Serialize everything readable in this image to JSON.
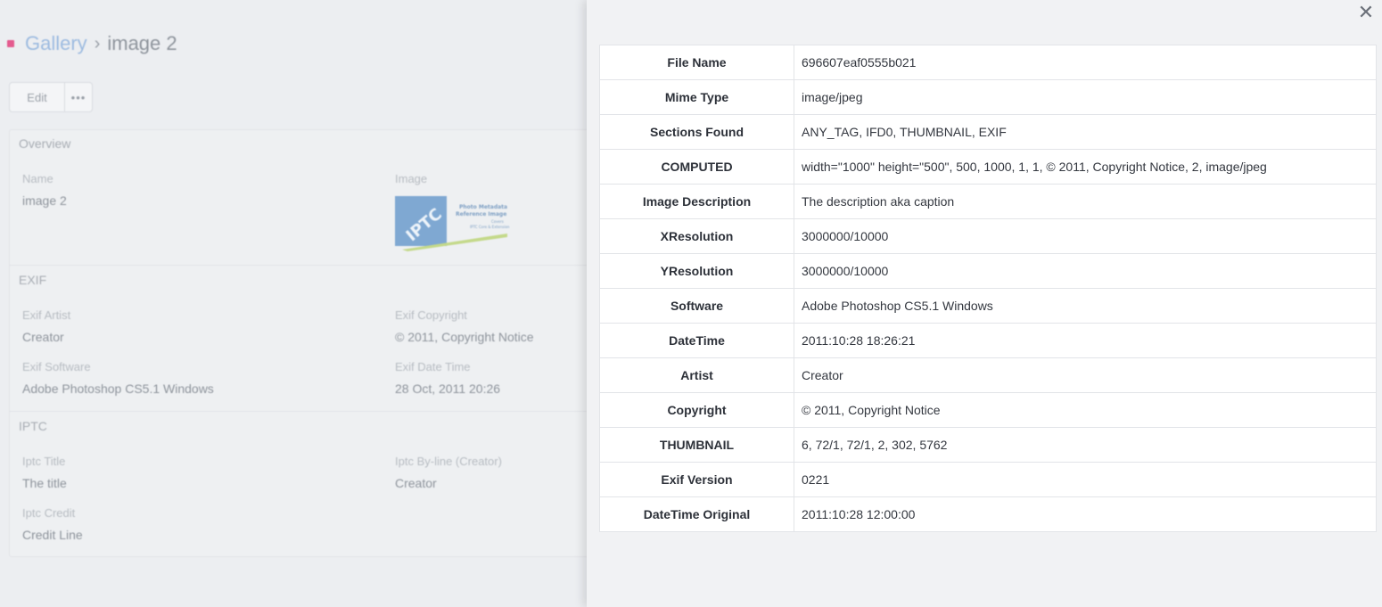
{
  "breadcrumb": {
    "parent": "Gallery",
    "separator": "›",
    "current": "image 2"
  },
  "toolbar": {
    "edit_label": "Edit",
    "more_label": "•••"
  },
  "overview": {
    "title": "Overview",
    "name_label": "Name",
    "name_value": "image 2",
    "image_label": "Image",
    "thumb_text": {
      "big": "IPTC",
      "line1": "Photo Metadata",
      "line2": "Reference Image",
      "line3": "Covers",
      "line4": "IPTC Core & Extension"
    }
  },
  "exif": {
    "title": "EXIF",
    "artist_label": "Exif Artist",
    "artist_value": "Creator",
    "copyright_label": "Exif Copyright",
    "copyright_value": "© 2011, Copyright Notice",
    "software_label": "Exif Software",
    "software_value": "Adobe Photoshop CS5.1 Windows",
    "datetime_label": "Exif Date Time",
    "datetime_value": "28 Oct, 2011 20:26"
  },
  "iptc": {
    "title": "IPTC",
    "title_label": "Iptc Title",
    "title_value": "The title",
    "byline_label": "Iptc By-line (Creator)",
    "byline_value": "Creator",
    "credit_label": "Iptc Credit",
    "credit_value": "Credit Line"
  },
  "panel": {
    "close_label": "✕",
    "rows": [
      {
        "key": "File Name",
        "value": "696607eaf0555b021"
      },
      {
        "key": "Mime Type",
        "value": "image/jpeg"
      },
      {
        "key": "Sections Found",
        "value": "ANY_TAG, IFD0, THUMBNAIL, EXIF"
      },
      {
        "key": "COMPUTED",
        "value": "width=\"1000\" height=\"500\", 500, 1000, 1, 1, © 2011, Copyright Notice, 2, image/jpeg"
      },
      {
        "key": "Image Description",
        "value": "The description aka caption"
      },
      {
        "key": "XResolution",
        "value": "3000000/10000"
      },
      {
        "key": "YResolution",
        "value": "3000000/10000"
      },
      {
        "key": "Software",
        "value": "Adobe Photoshop CS5.1 Windows"
      },
      {
        "key": "DateTime",
        "value": "2011:10:28 18:26:21"
      },
      {
        "key": "Artist",
        "value": "Creator"
      },
      {
        "key": "Copyright",
        "value": "© 2011, Copyright Notice"
      },
      {
        "key": "THUMBNAIL",
        "value": "6, 72/1, 72/1, 2, 302, 5762"
      },
      {
        "key": "Exif Version",
        "value": "0221"
      },
      {
        "key": "DateTime Original",
        "value": "2011:10:28 12:00:00"
      }
    ]
  },
  "colors": {
    "accent_pink": "#e45b8f",
    "link_blue": "#9dbbe0",
    "iptc_blue": "#3f86c6",
    "iptc_green": "#9bc13c"
  }
}
